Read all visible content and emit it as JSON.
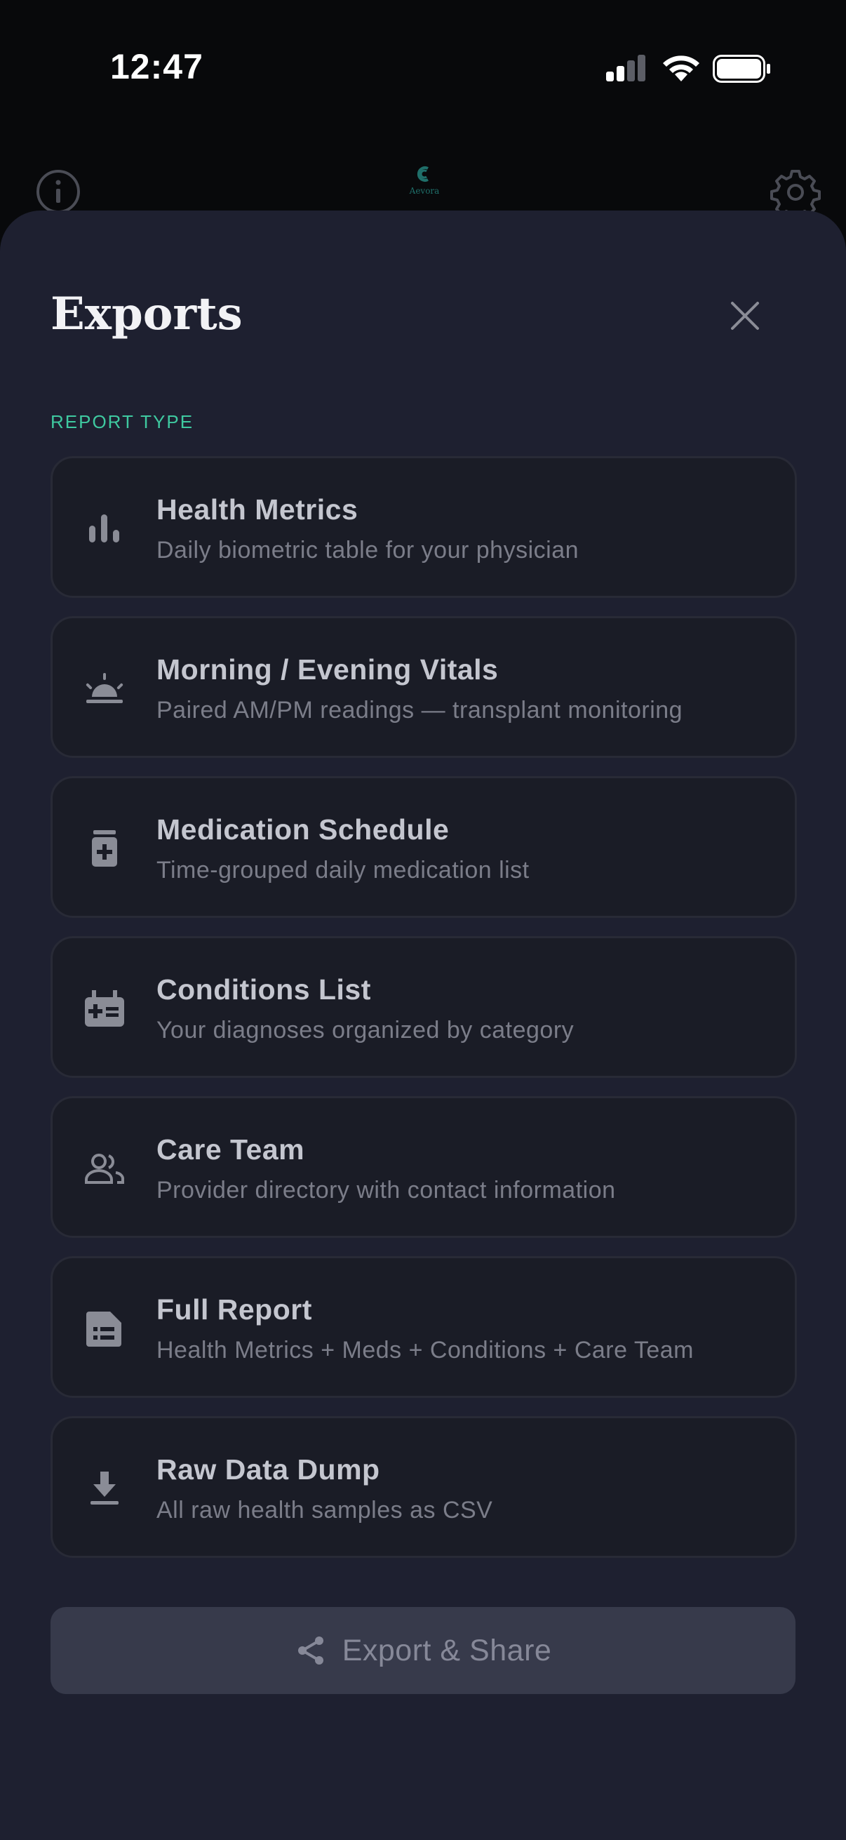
{
  "status_bar": {
    "time": "12:47",
    "signal_icon": "signal-bars-icon",
    "wifi_icon": "wifi-icon",
    "battery_icon": "battery-full-icon"
  },
  "header": {
    "logo_text": "Aevora",
    "info_icon": "info-icon",
    "settings_icon": "gear-icon"
  },
  "sheet": {
    "title": "Exports",
    "close_icon": "close-icon",
    "section_label": "REPORT TYPE",
    "report_types": [
      {
        "title": "Health Metrics",
        "subtitle": "Daily biometric table for your physician",
        "icon": "bar-chart-icon"
      },
      {
        "title": "Morning / Evening Vitals",
        "subtitle": "Paired AM/PM readings — transplant monitoring",
        "icon": "sunrise-icon"
      },
      {
        "title": "Medication Schedule",
        "subtitle": "Time-grouped daily medication list",
        "icon": "medication-bottle-icon"
      },
      {
        "title": "Conditions List",
        "subtitle": "Your diagnoses organized by category",
        "icon": "medical-kit-icon"
      },
      {
        "title": "Care Team",
        "subtitle": "Provider directory with contact information",
        "icon": "people-icon"
      },
      {
        "title": "Full Report",
        "subtitle": "Health Metrics + Meds + Conditions + Care Team",
        "icon": "document-icon"
      },
      {
        "title": "Raw Data Dump",
        "subtitle": "All raw health samples as CSV",
        "icon": "download-icon"
      }
    ],
    "export_button": {
      "label": "Export & Share",
      "icon": "share-icon"
    }
  },
  "colors": {
    "background": "#08090b",
    "sheet": "#1e2030",
    "card": "#1a1c26",
    "accent": "#3fc9a0",
    "logo": "#1f6f6a",
    "button": "#373a4b"
  }
}
